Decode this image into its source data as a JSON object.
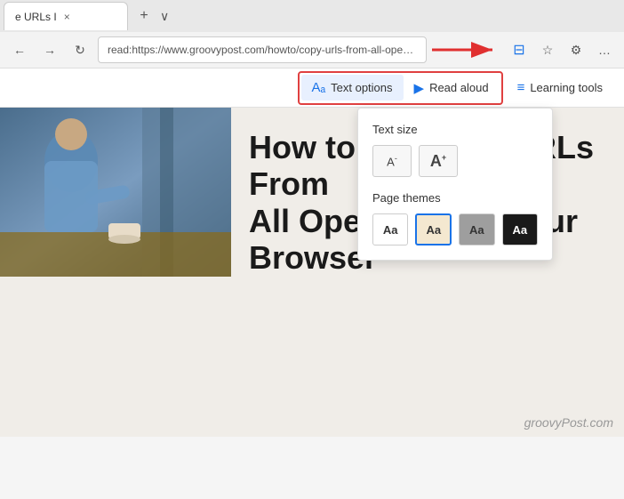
{
  "browser": {
    "tab": {
      "title": "e URLs I",
      "close": "×"
    },
    "tab_new": "+",
    "tab_more": "∨",
    "address": "read:https://www.groovypost.com/howto/copy-urls-from-all-open-tabs-in-browser/",
    "nav_buttons": [
      "←",
      "→",
      "↻"
    ],
    "toolbar_icons": {
      "reader_icon": "⊟",
      "star_icon": "☆",
      "menu_icon": "☰",
      "profile_icon": "⊕"
    }
  },
  "reader_toolbar": {
    "text_options_label": "Text options",
    "read_aloud_label": "Read aloud",
    "learning_tools_label": "Learning tools",
    "text_options_icon": "A↑",
    "read_aloud_icon": "A▶",
    "learning_tools_icon": "≡A"
  },
  "dropdown": {
    "text_size_title": "Text size",
    "decrease_label": "A-",
    "increase_label": "A+",
    "page_themes_title": "Page themes",
    "themes": [
      {
        "label": "Aa",
        "type": "white",
        "selected": false
      },
      {
        "label": "Aa",
        "type": "sepia",
        "selected": true
      },
      {
        "label": "Aa",
        "type": "gray",
        "selected": false
      },
      {
        "label": "Aa",
        "type": "dark",
        "selected": false
      }
    ]
  },
  "article": {
    "title_line1": "How to Copy the URLs From",
    "title_line2": "All Open Tabs in Your",
    "title_line3": "Browser",
    "watermark": "groovyPost.com"
  },
  "colors": {
    "accent_blue": "#1a73e8",
    "highlight_red": "#e04040",
    "sepia_bg": "#f0ede8"
  }
}
